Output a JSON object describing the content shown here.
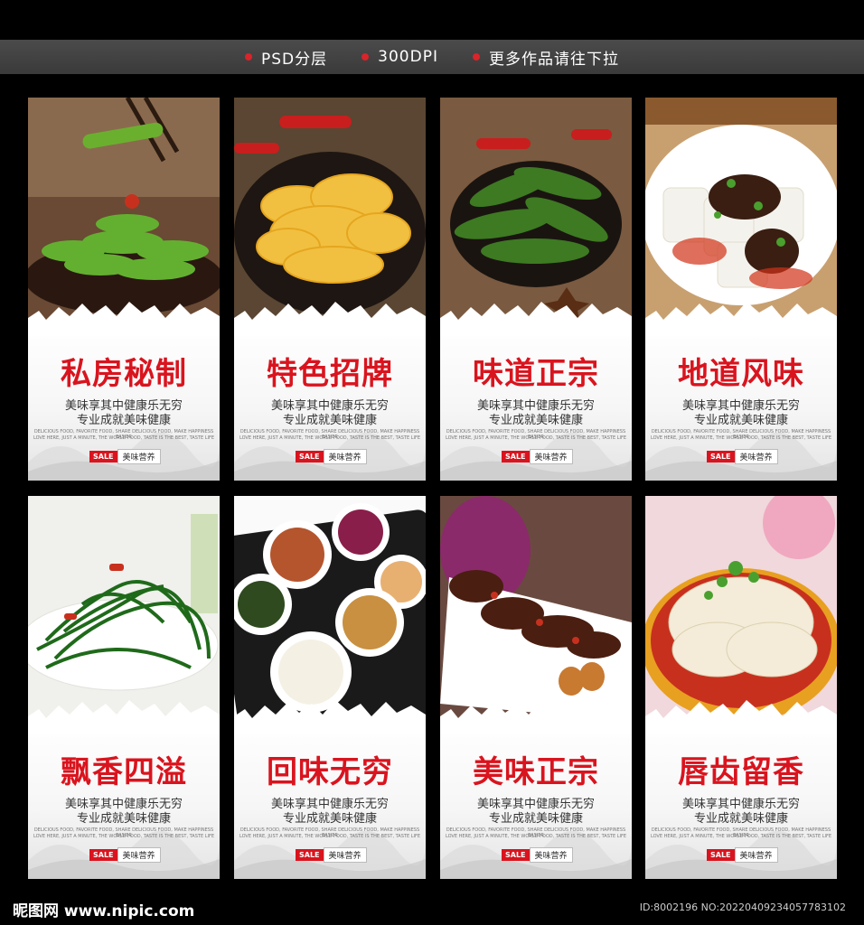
{
  "header": {
    "tags": [
      "PSD分层",
      "300DPI",
      "更多作品请往下拉"
    ]
  },
  "cards": [
    {
      "title": "私房秘制",
      "dish": "green-pepper-dish-photo"
    },
    {
      "title": "特色招牌",
      "dish": "pickled-radish-dish-photo"
    },
    {
      "title": "味道正宗",
      "dish": "pickled-pepper-dish-photo"
    },
    {
      "title": "地道风味",
      "dish": "jelly-tofu-dish-photo"
    },
    {
      "title": "飘香四溢",
      "dish": "wild-greens-dish-photo"
    },
    {
      "title": "回味无穷",
      "dish": "side-dishes-platter-photo"
    },
    {
      "title": "美味正宗",
      "dish": "braised-duck-dish-photo"
    },
    {
      "title": "唇齿留香",
      "dish": "jellyfish-salad-dish-photo"
    }
  ],
  "card_common": {
    "slogan_line1": "美味享其中健康乐无穷",
    "slogan_line2": "专业成就美味健康",
    "english_line1": "DELICIOUS FOOD, FAVORITE FOOD, SHARE DELICIOUS FOOD, MAKE HAPPINESS EASIER",
    "english_line2": "LOVE HERE, JUST A MINUTE, THE WORLD FOOD, TASTE IS THE BEST, TASTE LIFE",
    "sale_label": "SALE",
    "nutrition_label": "美味营养"
  },
  "footer": {
    "logo": "昵图网 www.nipic.com",
    "id_text": "ID:8002196 NO:20220409234057783102"
  },
  "colors": {
    "title_red": "#d9141e",
    "topbar": "#404040",
    "background": "#000000"
  }
}
